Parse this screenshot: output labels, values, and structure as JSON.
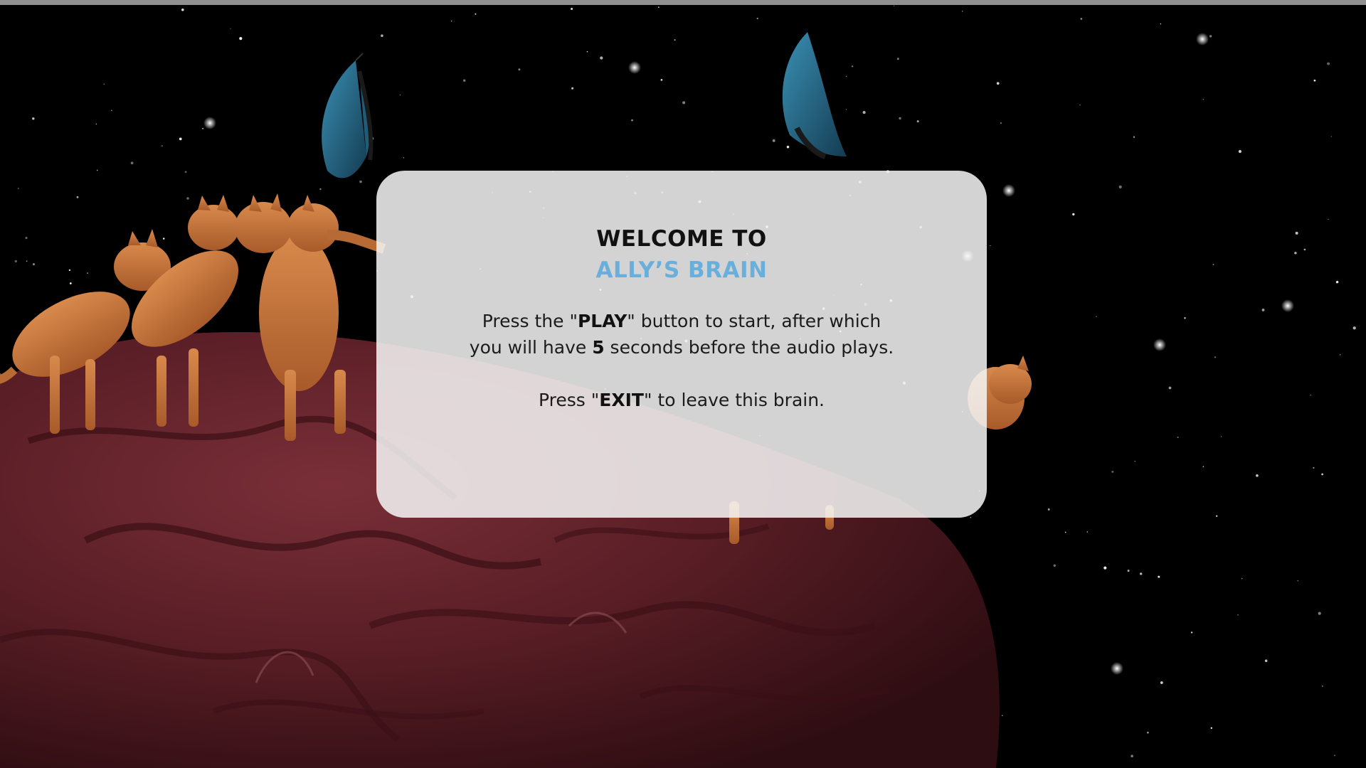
{
  "dialog": {
    "title_line1": "WELCOME TO",
    "title_line2": "ALLY’S BRAIN",
    "instructions": {
      "line1_a": "Press the \"",
      "line1_b": "PLAY",
      "line1_c": "\" button to start, after which",
      "line2_a": "you will have ",
      "line2_b": "5",
      "line2_c": " seconds before the audio plays.",
      "line3_a": "Press \"",
      "line3_b": "EXIT",
      "line3_c": "\" to leave this brain."
    }
  },
  "colors": {
    "background": "#000000",
    "dialog_background": "#f6f6f6",
    "title_primary": "#111111",
    "title_accent": "#6aaedb",
    "brain": "#5a1e26",
    "cat": "#c7733a",
    "butterfly": "#2a6f8c"
  },
  "scene_objects": [
    "starfield",
    "brain-planet",
    "cat-group",
    "butterfly",
    "butterfly"
  ]
}
